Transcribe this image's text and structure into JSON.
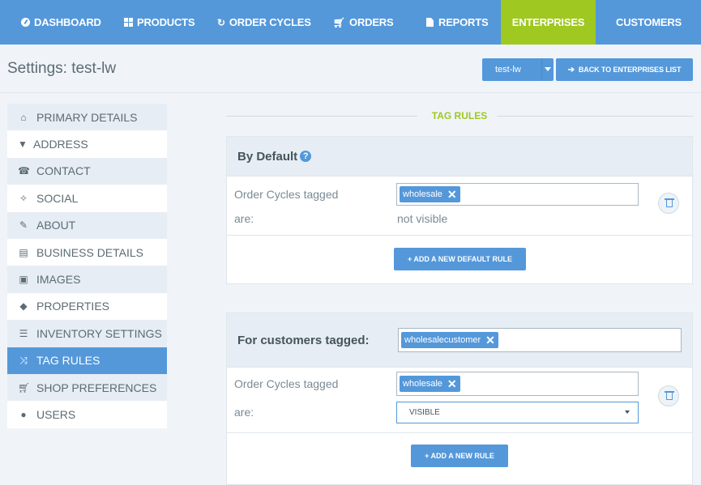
{
  "nav": {
    "items": [
      {
        "label": "DASHBOARD",
        "icon": "dashboard-icon"
      },
      {
        "label": "PRODUCTS",
        "icon": "grid-icon"
      },
      {
        "label": "ORDER CYCLES",
        "icon": "refresh-icon"
      },
      {
        "label": "ORDERS",
        "icon": "cart-icon"
      },
      {
        "label": "REPORTS",
        "icon": "document-icon"
      },
      {
        "label": "ENTERPRISES",
        "icon": ""
      },
      {
        "label": "CUSTOMERS",
        "icon": ""
      }
    ],
    "active": "ENTERPRISES"
  },
  "header": {
    "title": "Settings: test-lw",
    "enterprise_select": "test-lw",
    "back_button": "BACK TO ENTERPRISES LIST"
  },
  "sidebar": {
    "items": [
      {
        "label": "PRIMARY DETAILS",
        "icon": "home-icon"
      },
      {
        "label": "ADDRESS",
        "icon": "map-marker-icon"
      },
      {
        "label": "CONTACT",
        "icon": "phone-icon"
      },
      {
        "label": "SOCIAL",
        "icon": "twitter-icon"
      },
      {
        "label": "ABOUT",
        "icon": "pencil-icon"
      },
      {
        "label": "BUSINESS DETAILS",
        "icon": "briefcase-icon"
      },
      {
        "label": "IMAGES",
        "icon": "image-icon"
      },
      {
        "label": "PROPERTIES",
        "icon": "tags-icon"
      },
      {
        "label": "INVENTORY SETTINGS",
        "icon": "list-icon"
      },
      {
        "label": "TAG RULES",
        "icon": "shuffle-icon"
      },
      {
        "label": "SHOP PREFERENCES",
        "icon": "cart-icon"
      },
      {
        "label": "USERS",
        "icon": "user-icon"
      }
    ],
    "active": "TAG RULES"
  },
  "main": {
    "section_title": "TAG RULES",
    "default_panel": {
      "title": "By Default",
      "rule_label_line1": "Order Cycles tagged",
      "rule_label_line2": "are:",
      "tag": "wholesale",
      "visibility": "not visible",
      "add_button": "+ ADD A NEW DEFAULT RULE"
    },
    "customer_panel": {
      "title": "For customers tagged:",
      "customer_tag": "wholesalecustomer",
      "rule_label_line1": "Order Cycles tagged",
      "rule_label_line2": "are:",
      "tag": "wholesale",
      "visibility_select": "VISIBLE",
      "add_button": "+ ADD A NEW RULE"
    }
  },
  "colors": {
    "primary": "#5498da",
    "accent": "#9fc820",
    "background": "#f0f4f8"
  }
}
